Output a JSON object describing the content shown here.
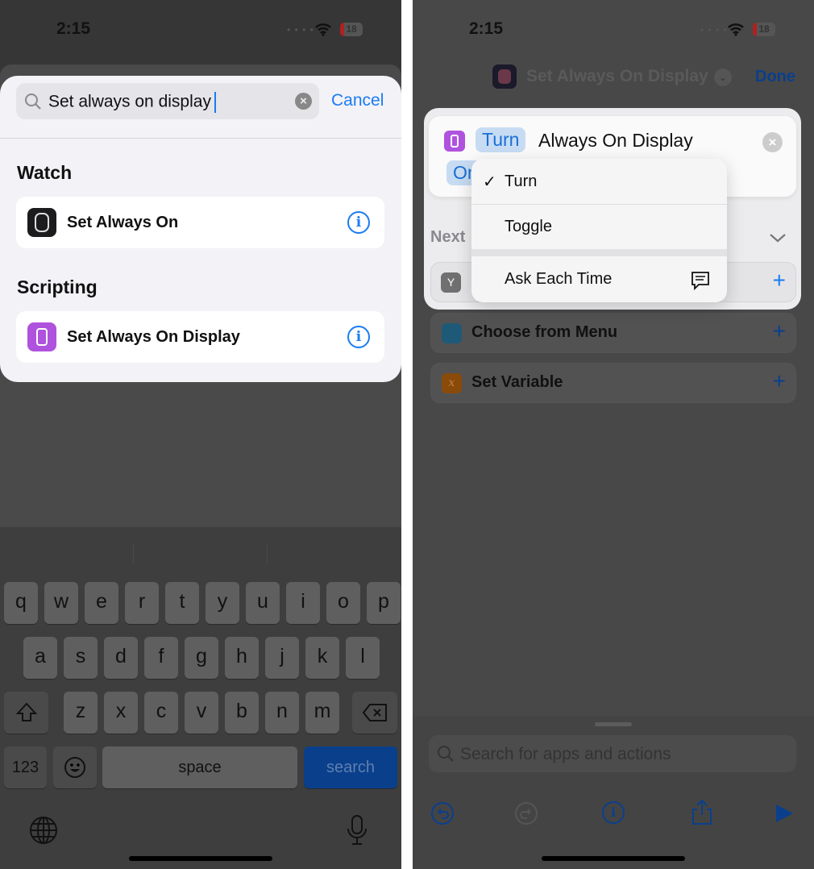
{
  "left": {
    "status": {
      "time": "2:15",
      "battery": "18"
    },
    "search": {
      "value": "Set always on display",
      "cancel": "Cancel"
    },
    "sections": [
      {
        "title": "Watch",
        "items": [
          {
            "label": "Set Always On",
            "icon": "watch-icon",
            "color": "#1c1c1e"
          }
        ]
      },
      {
        "title": "Scripting",
        "items": [
          {
            "label": "Set Always On Display",
            "icon": "phone-icon",
            "color": "#af52de"
          }
        ]
      }
    ],
    "keyboard": {
      "row1": [
        "q",
        "w",
        "e",
        "r",
        "t",
        "y",
        "u",
        "i",
        "o",
        "p"
      ],
      "row2": [
        "a",
        "s",
        "d",
        "f",
        "g",
        "h",
        "j",
        "k",
        "l"
      ],
      "row3": [
        "z",
        "x",
        "c",
        "v",
        "b",
        "n",
        "m"
      ],
      "numbers": "123",
      "space": "space",
      "search": "search"
    }
  },
  "right": {
    "status": {
      "time": "2:15",
      "battery": "18"
    },
    "nav": {
      "title": "Set Always On Display",
      "done": "Done"
    },
    "action": {
      "verb": "Turn",
      "text": "Always On Display",
      "value": "On"
    },
    "menu": {
      "items": [
        {
          "label": "Turn",
          "checked": true
        },
        {
          "label": "Toggle",
          "checked": false
        },
        {
          "label": "Ask Each Time",
          "checked": false
        }
      ]
    },
    "next_label": "Next",
    "suggestions": [
      {
        "label": "Choose from Menu",
        "color": "#1e5a78"
      },
      {
        "label": "Set Variable",
        "color": "#8a4a0a"
      }
    ],
    "bottom_search_placeholder": "Search for apps and actions",
    "accent": "#1a7cf2"
  }
}
